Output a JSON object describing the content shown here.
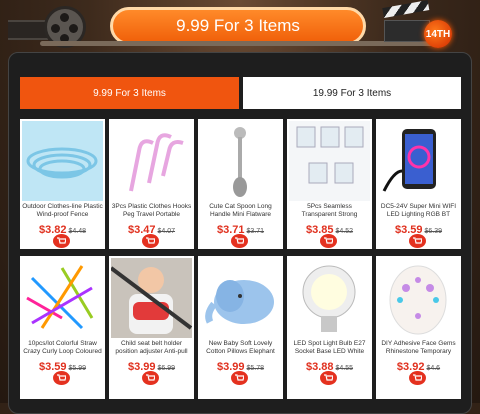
{
  "header": {
    "title": "9.99 For 3 Items",
    "badge": "14TH"
  },
  "tabs": [
    {
      "label": "9.99 For 3 Items",
      "active": true
    },
    {
      "label": "19.99 For 3 Items",
      "active": false
    }
  ],
  "products": [
    {
      "name": "Outdoor Clothes-line Plastic Wind-proof Fence",
      "price": "$3.82",
      "old_price": "$4.48",
      "icon": "clothesline-image"
    },
    {
      "name": "3Pcs Plastic Clothes Hooks Peg Travel Portable",
      "price": "$3.47",
      "old_price": "$4.07",
      "icon": "hooks-image"
    },
    {
      "name": "Cute Cat Spoon Long Handle Mini Flatware",
      "price": "$3.71",
      "old_price": "$3.71",
      "icon": "spoon-image"
    },
    {
      "name": "5Pcs Seamless Transparent Strong",
      "price": "$3.85",
      "old_price": "$4.52",
      "icon": "wall-hooks-image"
    },
    {
      "name": "DC5-24V Super Mini WIFI LED Lighting RGB BT",
      "price": "$3.59",
      "old_price": "$6.39",
      "icon": "led-controller-image"
    },
    {
      "name": "10pcs/lot Colorful Straw Crazy Curly Loop Coloured",
      "price": "$3.59",
      "old_price": "$5.99",
      "icon": "straws-image"
    },
    {
      "name": "Child seat belt holder position adjuster Anti-pull",
      "price": "$3.99",
      "old_price": "$6.99",
      "icon": "seat-belt-image"
    },
    {
      "name": "New Baby Soft Lovely Cotton Pillows Elephant",
      "price": "$3.99",
      "old_price": "$5.78",
      "icon": "elephant-pillow-image"
    },
    {
      "name": "LED Spot Light Bulb E27 Socket Base LED White",
      "price": "$3.88",
      "old_price": "$4.55",
      "icon": "led-bulb-image"
    },
    {
      "name": "DIY Adhesive Face Gems Rhinestone Temporary",
      "price": "$3.92",
      "old_price": "$4.6",
      "icon": "face-gems-image"
    }
  ],
  "colors": {
    "accent": "#f0550f",
    "price": "#e0301e"
  }
}
